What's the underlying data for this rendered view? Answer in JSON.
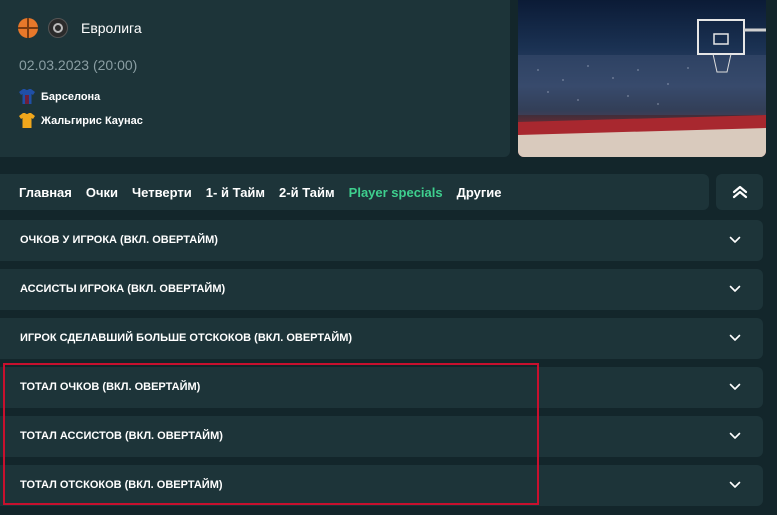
{
  "match": {
    "league": "Евролига",
    "date": "02.03.2023 (20:00)",
    "team_home": "Барселона",
    "team_away": "Жальгирис Каунас",
    "home_color": "#1f4fa6",
    "away_color": "#f0a71c"
  },
  "tabs": [
    {
      "label": "Главная"
    },
    {
      "label": "Очки"
    },
    {
      "label": "Четверти"
    },
    {
      "label": "1- й Тайм"
    },
    {
      "label": "2-й Тайм"
    },
    {
      "label": "Player specials"
    },
    {
      "label": "Другие"
    }
  ],
  "active_tab_color": "#3ecf8e",
  "markets": [
    {
      "label": "ОЧКОВ У ИГРОКА (ВКЛ. ОВЕРТАЙМ)"
    },
    {
      "label": "АССИСТЫ ИГРОКА (ВКЛ. ОВЕРТАЙМ)"
    },
    {
      "label": "ИГРОК СДЕЛАВШИЙ БОЛЬШЕ ОТСКОКОВ (ВКЛ. ОВЕРТАЙМ)"
    },
    {
      "label": "ТОТАЛ ОЧКОВ (ВКЛ. ОВЕРТАЙМ)"
    },
    {
      "label": "ТОТАЛ АССИСТОВ (ВКЛ. ОВЕРТАЙМ)"
    },
    {
      "label": "ТОТАЛ ОТСКОКОВ (ВКЛ. ОВЕРТАЙМ)"
    }
  ],
  "highlight_color": "#c8102e"
}
